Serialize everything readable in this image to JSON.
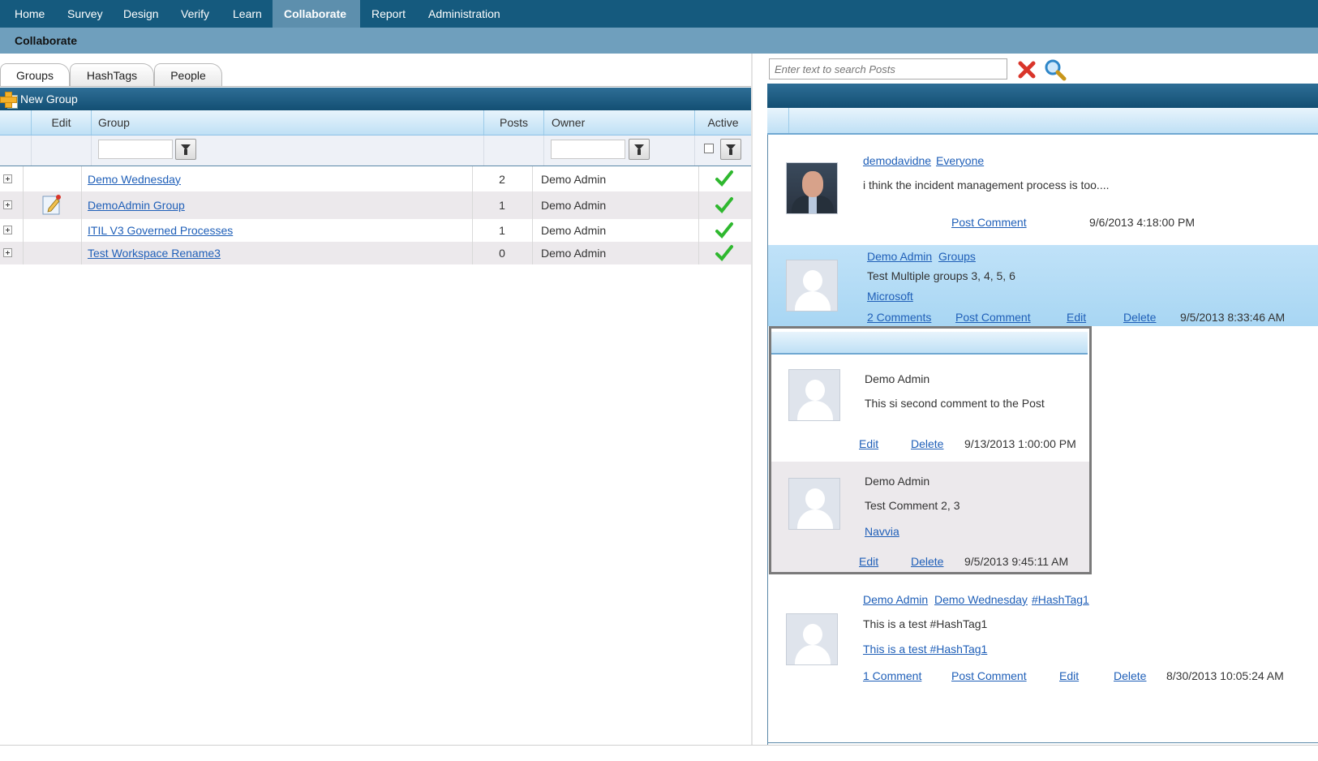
{
  "nav": {
    "items": [
      "Home",
      "Survey",
      "Design",
      "Verify",
      "Learn",
      "Collaborate",
      "Report",
      "Administration"
    ],
    "active": "Collaborate"
  },
  "subheader": {
    "title": "Collaborate"
  },
  "tabs": [
    "Groups",
    "HashTags",
    "People"
  ],
  "toolbar": {
    "new_group_label": "New Group"
  },
  "grid": {
    "columns": {
      "edit": "Edit",
      "group": "Group",
      "posts": "Posts",
      "owner": "Owner",
      "active": "Active"
    },
    "rows": [
      {
        "group": "Demo Wednesday",
        "posts": "2",
        "owner": "Demo Admin",
        "active": true,
        "editable": false
      },
      {
        "group": "DemoAdmin Group",
        "posts": "1",
        "owner": "Demo Admin",
        "active": true,
        "editable": true
      },
      {
        "group": "ITIL V3 Governed Processes",
        "posts": "1",
        "owner": "Demo Admin",
        "active": true,
        "editable": false
      },
      {
        "group": "Test Workspace Rename3",
        "posts": "0",
        "owner": "Demo Admin",
        "active": true,
        "editable": false
      }
    ]
  },
  "search": {
    "placeholder": "Enter text to search Posts"
  },
  "posts": [
    {
      "author": "demodavidne",
      "audience": "Everyone",
      "text": "i think the incident management process is too....",
      "post_comment": "Post Comment",
      "timestamp": "9/6/2013 4:18:00 PM"
    },
    {
      "author": "Demo Admin",
      "audience": "Groups",
      "text": "Test Multiple groups 3, 4, 5, 6",
      "tag": "Microsoft",
      "comments": "2 Comments",
      "post_comment": "Post Comment",
      "edit": "Edit",
      "delete": "Delete",
      "timestamp": "9/5/2013 8:33:46 AM"
    },
    {
      "author": "Demo Admin",
      "audience": "Demo Wednesday",
      "hashtag": "#HashTag1",
      "text": "This is a test #HashTag1",
      "link": "This is a test #HashTag1",
      "comments": "1 Comment",
      "post_comment": "Post Comment",
      "edit": "Edit",
      "delete": "Delete",
      "timestamp": "8/30/2013 10:05:24 AM"
    }
  ],
  "comments": [
    {
      "author": "Demo Admin",
      "text": "This si second comment to the Post",
      "edit": "Edit",
      "delete": "Delete",
      "timestamp": "9/13/2013 1:00:00 PM"
    },
    {
      "author": "Demo Admin",
      "text": "Test Comment 2, 3",
      "tag": "Navvia",
      "edit": "Edit",
      "delete": "Delete",
      "timestamp": "9/5/2013 9:45:11 AM"
    }
  ],
  "colors": {
    "nav_bg": "#155a7e",
    "nav_active": "#5d8fad",
    "link": "#1f5fb8",
    "highlight": "#b3dbf5",
    "check": "#2fb82f",
    "clear": "#d9352a"
  }
}
